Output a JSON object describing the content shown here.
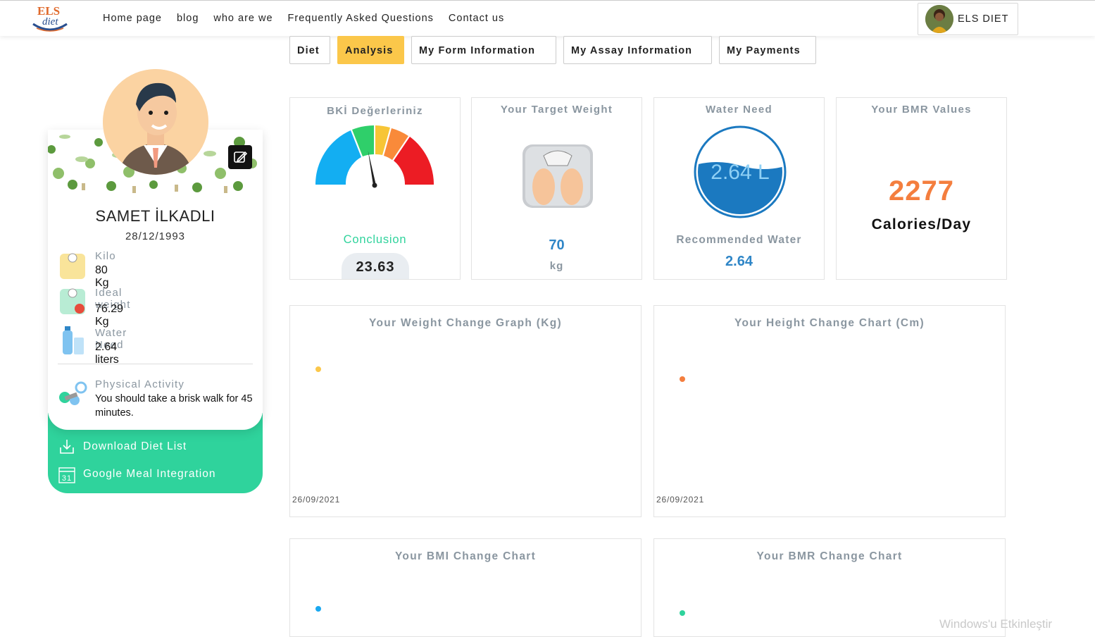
{
  "header": {
    "logo_text_top": "ELS",
    "logo_text_bottom": "diet",
    "nav": [
      "Home page",
      "blog",
      "who are we",
      "Frequently Asked Questions",
      "Contact us"
    ],
    "user_name": "ELS DIET"
  },
  "tabs": [
    {
      "label": "Diet",
      "active": false
    },
    {
      "label": "Analysis",
      "active": true
    },
    {
      "label": "My Form Information",
      "active": false
    },
    {
      "label": "My Assay Information",
      "active": false
    },
    {
      "label": "My Payments",
      "active": false
    }
  ],
  "profile": {
    "name": "SAMET İLKADLI",
    "dob": "28/12/1993",
    "kilo_label": "Kilo",
    "kilo_value": "80 Kg",
    "ideal_label": "Ideal weight",
    "ideal_value": "76.29 Kg",
    "water_label": "Water Need",
    "water_value": "2.64 liters",
    "activity_label": "Physical Activity",
    "activity_text": "You should take a brisk walk for 45 minutes.",
    "download_label": "Download Diet List",
    "google_label": "Google Meal Integration",
    "calendar_day": "31"
  },
  "cards": {
    "bmi": {
      "title": "BKİ Değerleriniz",
      "conclusion_label": "Conclusion",
      "value": "23.63",
      "gauge_fraction": 0.44
    },
    "target": {
      "title": "Your Target Weight",
      "value": "70",
      "unit": "kg"
    },
    "water": {
      "title": "Water Need",
      "gauge_text": "2.64 L",
      "rec_label": "Recommended Water",
      "value": "2.64"
    },
    "bmr": {
      "title": "Your BMR Values",
      "value": "2277",
      "unit": "Calories/Day"
    }
  },
  "charts": {
    "weight": {
      "title": "Your Weight Change Graph (Kg)",
      "date": "26/09/2021"
    },
    "height": {
      "title": "Your Height Change Chart (Cm)",
      "date": "26/09/2021"
    },
    "bmi": {
      "title": "Your BMI Change Chart"
    },
    "bmr": {
      "title": "Your BMR Change Chart"
    }
  },
  "chart_data": [
    {
      "type": "line",
      "title": "Your Weight Change Graph (Kg)",
      "x": [
        "26/09/2021"
      ],
      "series": [
        {
          "values": [
            80
          ]
        }
      ],
      "color": "#fbc74a"
    },
    {
      "type": "line",
      "title": "Your Height Change Chart (Cm)",
      "x": [
        "26/09/2021"
      ],
      "series": [
        {
          "values": [
            null
          ]
        }
      ],
      "color": "#f47e3e"
    },
    {
      "type": "line",
      "title": "Your BMI Change Chart",
      "x": [
        "26/09/2021"
      ],
      "series": [
        {
          "values": [
            23.63
          ]
        }
      ],
      "color": "#1aa8f0"
    },
    {
      "type": "line",
      "title": "Your BMR Change Chart",
      "x": [
        "26/09/2021"
      ],
      "series": [
        {
          "values": [
            2277
          ]
        }
      ],
      "color": "#2fd39c"
    }
  ],
  "colors": {
    "accent_yellow": "#fbc74a",
    "green": "#2fd39c",
    "blue": "#2f86c7",
    "orange": "#f47e3e",
    "conclusion_green": "#2fd39c"
  },
  "watermark": "Windows'u Etkinleştir"
}
